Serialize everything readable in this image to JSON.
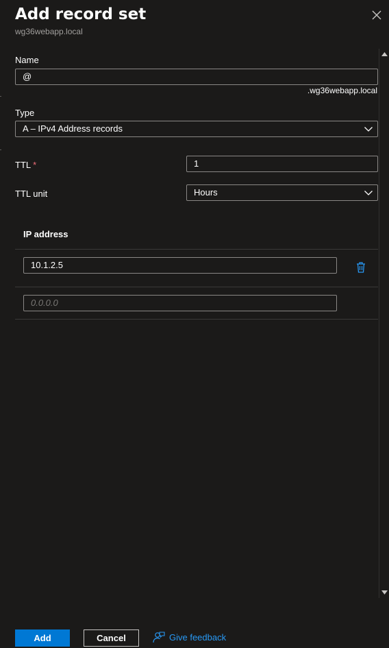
{
  "header": {
    "title": "Add record set",
    "subtitle": "wg36webapp.local",
    "close_icon": "close-icon"
  },
  "form": {
    "name": {
      "label": "Name",
      "value": "@",
      "suffix": ".wg36webapp.local"
    },
    "type": {
      "label": "Type",
      "selected": "A – IPv4 Address records"
    },
    "ttl": {
      "label": "TTL",
      "required_marker": "*",
      "value": "1"
    },
    "ttl_unit": {
      "label": "TTL unit",
      "selected": "Hours"
    }
  },
  "ip_table": {
    "header": "IP address",
    "rows": [
      {
        "value": "10.1.2.5"
      }
    ],
    "new_row_placeholder": "0.0.0.0",
    "delete_icon": "trash-icon"
  },
  "footer": {
    "add_label": "Add",
    "cancel_label": "Cancel",
    "feedback_label": "Give feedback",
    "feedback_icon": "feedback-person-icon"
  },
  "colors": {
    "background": "#1b1a19",
    "accent": "#0078d4",
    "link": "#2899f5",
    "required": "#f1707b",
    "border": "#8a8886"
  }
}
